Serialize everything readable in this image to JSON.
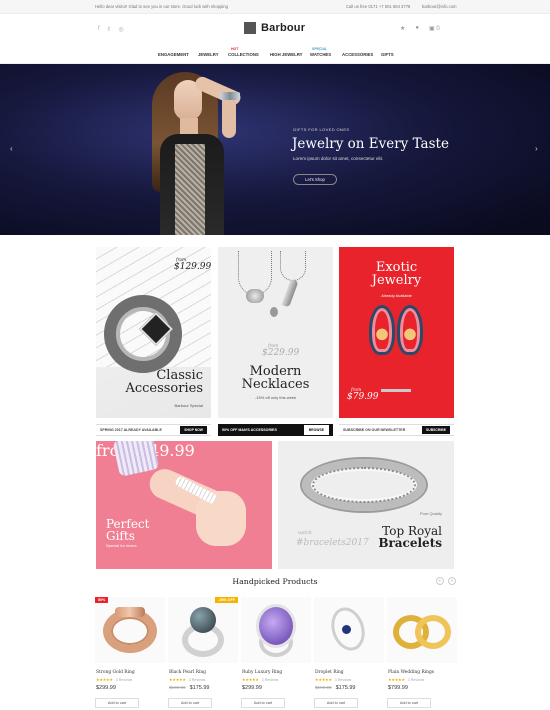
{
  "topbar": {
    "welcome": "Hello dear visitor! Glad to see you in our store. Good luck with shopping",
    "phone": "Call us free 0171 +7 501 564 3778",
    "email": "barbour@info.com"
  },
  "header": {
    "logo_text": "Barbour",
    "social_icons": [
      "facebook-icon",
      "twitter-icon",
      "instagram-icon"
    ],
    "right_icons": [
      "star-icon",
      "user-icon",
      "cart-icon"
    ],
    "cart_count": "0"
  },
  "nav": {
    "items": [
      {
        "label": "ENGAGEMENT",
        "badge": ""
      },
      {
        "label": "JEWELRY",
        "badge": ""
      },
      {
        "label": "COLLECTIONS",
        "badge": "HOT"
      },
      {
        "label": "HIGH JEWELRY",
        "badge": ""
      },
      {
        "label": "WATCHES",
        "badge": "SPECIAL"
      },
      {
        "label": "ACCESSORIES",
        "badge": ""
      },
      {
        "label": "GIFTS",
        "badge": ""
      }
    ],
    "badge_colors": {
      "HOT": "#e8232b",
      "SPECIAL": "#39a5c5"
    }
  },
  "hero": {
    "kicker": "GIFTS FOR LOVED ONES",
    "title": "Jewelry on Every Taste",
    "subtitle": "Lorem ipsum dolor sit amet, consectetur elit.",
    "button": "Let's Shop",
    "prev_icon": "chevron-left-icon",
    "next_icon": "chevron-right-icon"
  },
  "promos": {
    "classic": {
      "from": "from",
      "price": "$129.99",
      "title_line1": "Classic",
      "title_line2": "Accessories",
      "subtitle": "Barbour Special"
    },
    "necklaces": {
      "from": "from",
      "price": "$229.99",
      "title_line1": "Modern",
      "title_line2": "Necklaces",
      "subtitle": "-15% off only this week"
    },
    "exotic": {
      "title_line1": "Exotic",
      "title_line2": "Jewelry",
      "subtitle": "Already Available",
      "from": "from",
      "price": "$79.99"
    }
  },
  "strips": [
    {
      "text": "SPRING 2017 ALREADY AVAILABLE",
      "button": "SHOP NOW"
    },
    {
      "text": "50% OFF MAN'S ACCESSORIES",
      "button": "BROWSE"
    },
    {
      "text": "SUBSCRIBE ON OUR NEWSLETTER",
      "button": "SUBSCRIBE"
    }
  ],
  "banners": {
    "gifts": {
      "title_line1": "Perfect",
      "title_line2": "Gifts",
      "subtitle": "Special for lovers",
      "from": "from",
      "price": "$49.99"
    },
    "bracelets": {
      "label": "Pure Quality",
      "title_line1": "Top Royal",
      "title_line2": "Bracelets",
      "ghost1": "watch",
      "ghost2": "#bracelets2017"
    }
  },
  "handpicked": {
    "title": "Handpicked Products",
    "prev_icon": "chevron-left-icon",
    "next_icon": "chevron-right-icon",
    "products": [
      {
        "name": "Strong Gold Ring",
        "stars": "★★★★★",
        "reviews": "3 Reviews",
        "old_price": "",
        "price": "$299.99",
        "cart": "Add to cart",
        "tag": "50%",
        "tag_color": "#e8232b"
      },
      {
        "name": "Black Pearl Ring",
        "stars": "★★★★★",
        "reviews": "3 Reviews",
        "old_price": "$199.99",
        "price": "$175.99",
        "cart": "Add to cart",
        "tag": "-50% OFF",
        "tag_color": "#f5b400"
      },
      {
        "name": "Ruby Luxury Ring",
        "stars": "★★★★★",
        "reviews": "3 Reviews",
        "old_price": "",
        "price": "$299.99",
        "cart": "Add to cart",
        "tag": "",
        "tag_color": ""
      },
      {
        "name": "Droplet Ring",
        "stars": "★★★★★",
        "reviews": "3 Reviews",
        "old_price": "$199.99",
        "price": "$175.99",
        "cart": "Add to cart",
        "tag": "",
        "tag_color": ""
      },
      {
        "name": "Plain Wedding Rings",
        "stars": "★★★★★",
        "reviews": "3 Reviews",
        "old_price": "",
        "price": "$799.99",
        "cart": "Add to cart",
        "tag": "",
        "tag_color": ""
      }
    ]
  }
}
